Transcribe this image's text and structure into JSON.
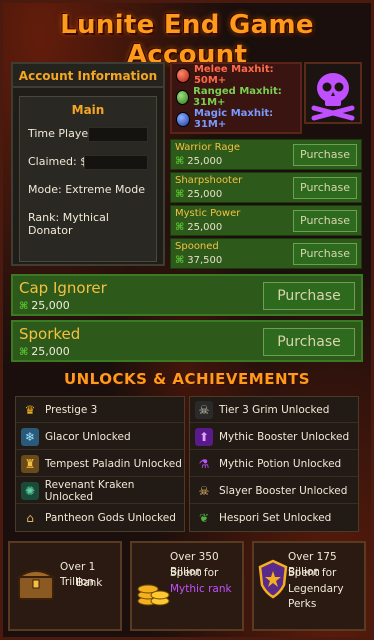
{
  "title": "Lunite End Game Account",
  "account_info": {
    "header": "Account Information",
    "section_title": "Main",
    "time_played_label": "Time Played:",
    "claimed_label": "Claimed: $",
    "mode_label": "Mode:",
    "mode_value": "Extreme Mode",
    "rank_label": "Rank:",
    "rank_value": "Mythical Donator"
  },
  "maxhits": [
    {
      "label": "Melee Maxhit: 50M+",
      "color": "#d8402a"
    },
    {
      "label": "Ranged Maxhit: 31M+",
      "color": "#4caf30"
    },
    {
      "label": "Magic Maxhit: 31M+",
      "color": "#3a6ad8"
    }
  ],
  "perks": [
    {
      "name": "Warrior Rage",
      "cost": "25,000",
      "button": "Purchase"
    },
    {
      "name": "Sharpshooter",
      "cost": "25,000",
      "button": "Purchase"
    },
    {
      "name": "Mystic Power",
      "cost": "25,000",
      "button": "Purchase"
    },
    {
      "name": "Spooned",
      "cost": "37,500",
      "button": "Purchase"
    }
  ],
  "big_perks": [
    {
      "name": "Cap Ignorer",
      "cost": "25,000",
      "button": "Purchase"
    },
    {
      "name": "Sporked",
      "cost": "25,000",
      "button": "Purchase"
    }
  ],
  "unlocks_title": "UNLOCKS & ACHIEVEMENTS",
  "unlocks_left": [
    {
      "label": "Prestige 3",
      "icon": "crown-icon"
    },
    {
      "label": "Glacor Unlocked",
      "icon": "glacor-icon"
    },
    {
      "label": "Tempest Paladin Unlocked",
      "icon": "paladin-icon"
    },
    {
      "label": "Revenant Kraken Unlocked",
      "icon": "kraken-icon"
    },
    {
      "label": "Pantheon Gods Unlocked",
      "icon": "pantheon-icon"
    }
  ],
  "unlocks_right": [
    {
      "label": "Tier 3 Grim Unlocked",
      "icon": "grim-icon"
    },
    {
      "label": "Mythic Booster Unlocked",
      "icon": "booster-icon"
    },
    {
      "label": "Mythic Potion Unlocked",
      "icon": "potion-icon"
    },
    {
      "label": "Slayer Booster Unlocked",
      "icon": "slayer-skull-icon"
    },
    {
      "label": "Hespori Set Unlocked",
      "icon": "hespori-icon"
    }
  ],
  "stats": [
    {
      "line1": "Over 1 Trillion",
      "line2": "Bank",
      "line3": ""
    },
    {
      "line1": "Over 350 Billion",
      "line2": "Spent for",
      "line3": "Mythic rank"
    },
    {
      "line1": "Over 175 Billion",
      "line2": "Spent for",
      "line3": "Legendary Perks"
    }
  ],
  "colors": {
    "accent_orange": "#ff9a1a",
    "perk_green": "#2d5a1a",
    "mythic_purple": "#c050ff"
  }
}
